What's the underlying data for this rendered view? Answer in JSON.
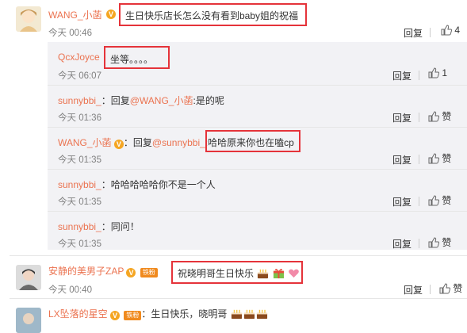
{
  "comments": [
    {
      "user": "WANG_小菡",
      "text": "生日快乐店长怎么没有看到baby姐的祝福",
      "time": "今天 00:46",
      "reply_label": "回复",
      "likes": "4"
    },
    {
      "user": "安静的美男子ZAP",
      "badge": "铁粉",
      "text": "祝晓明哥生日快乐",
      "time": "今天 00:40",
      "reply_label": "回复",
      "likes": "赞"
    },
    {
      "user": "LX坠落的星空",
      "badge": "铁粉",
      "text": "：生日快乐，晓明哥"
    }
  ],
  "replies": [
    {
      "user": "QcxJoyce",
      "text": "坐等。。。。",
      "time": "今天 06:07",
      "reply_label": "回复",
      "likes": "1"
    },
    {
      "user": "sunnybbi_",
      "text_prefix": "：回复",
      "mention": "@WANG_小菡",
      "text": ":是的呢",
      "time": "今天 01:36",
      "reply_label": "回复",
      "likes": "赞"
    },
    {
      "user": "WANG_小菡",
      "text_prefix": "：回复",
      "mention": "@sunnybbi_",
      "text": ":哈哈原来你也在嗑cp",
      "time": "今天 01:35",
      "reply_label": "回复",
      "likes": "赞"
    },
    {
      "user": "sunnybbi_",
      "text": "：哈哈哈哈哈你不是一个人",
      "time": "今天 01:35",
      "reply_label": "回复",
      "likes": "赞"
    },
    {
      "user": "sunnybbi_",
      "text": "：同问！",
      "time": "今天 01:35",
      "reply_label": "回复",
      "likes": "赞"
    }
  ],
  "colors": {
    "username": "#eb7350",
    "highlight": "#e5333a",
    "reply_bg": "#f2f2f5",
    "vip_badge": "#f5a623"
  },
  "icons": {
    "vip": "vip-crown-icon",
    "like": "thumbs-up-icon",
    "cake": "cake-emoji-icon",
    "gift": "gift-emoji-icon",
    "heart": "heart-emoji-icon"
  }
}
